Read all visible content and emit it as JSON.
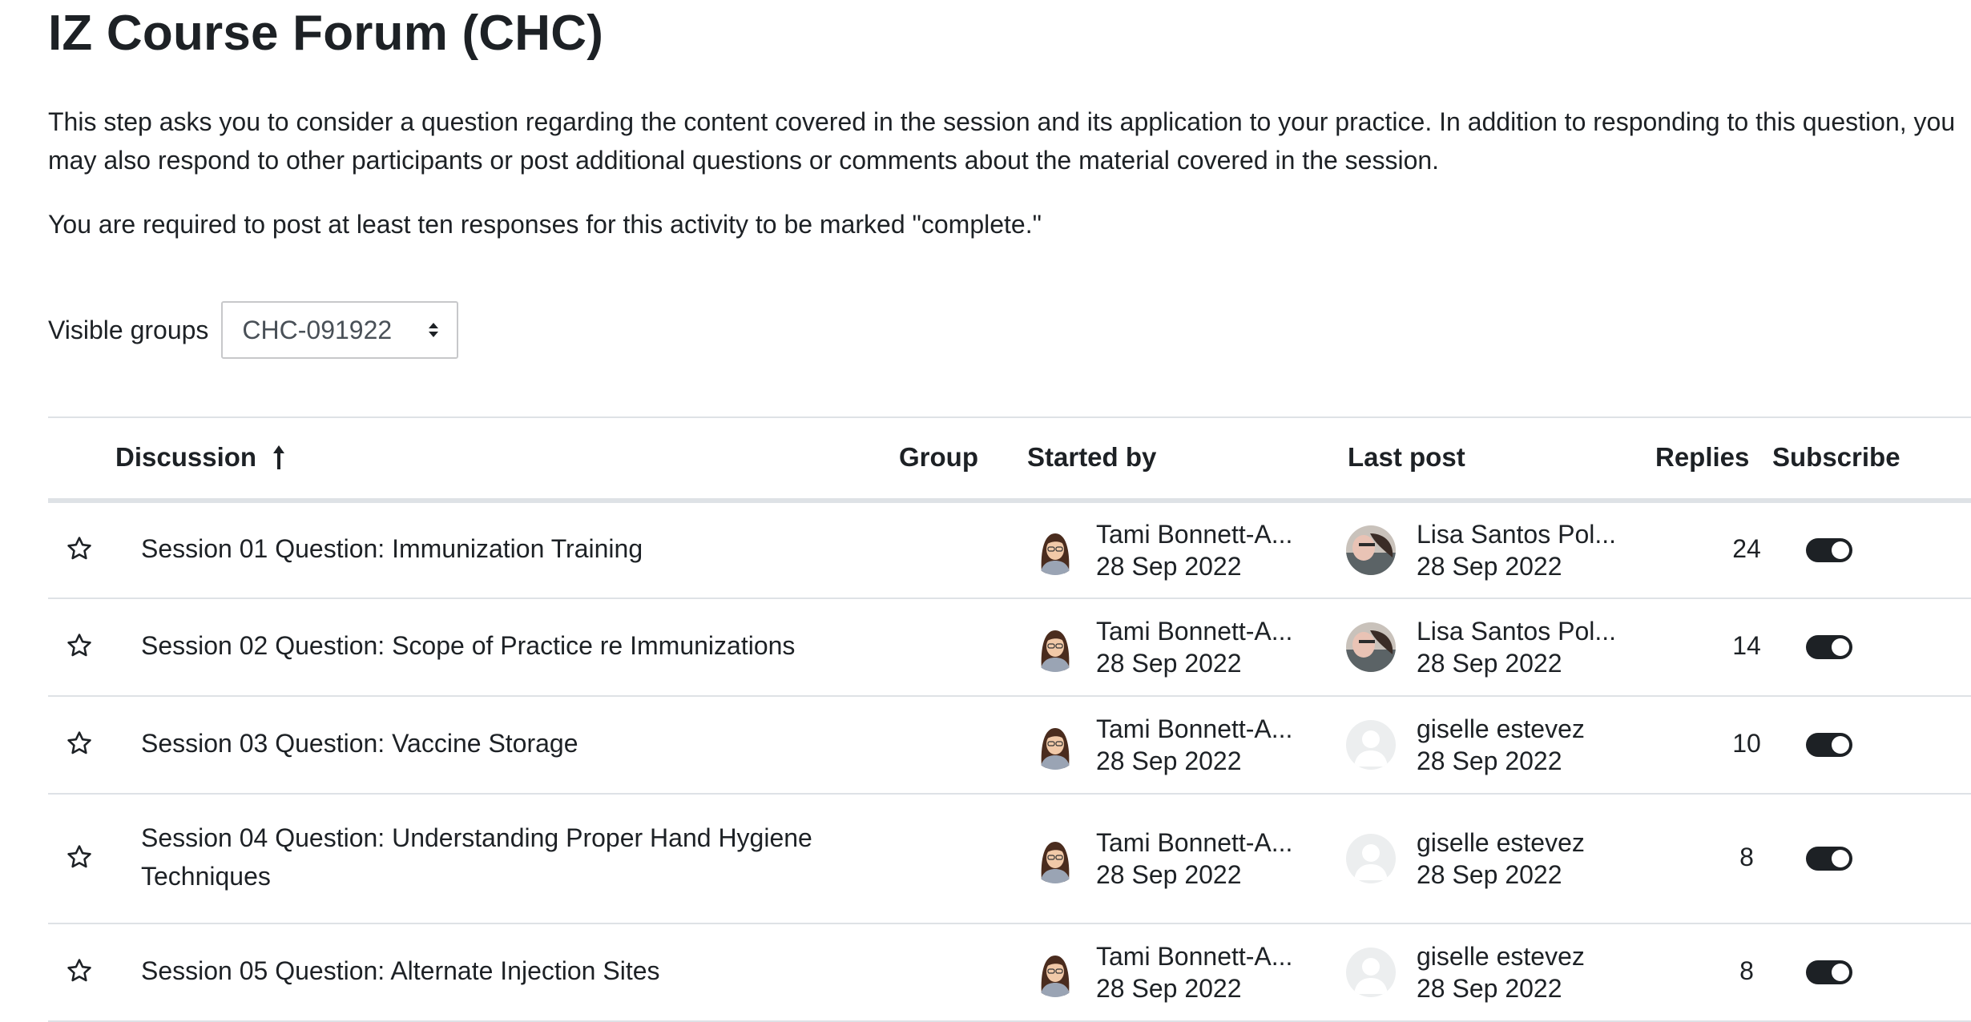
{
  "page": {
    "title": "IZ Course Forum (CHC)",
    "intro": "This step asks you to consider a question regarding the content covered in the session and its application to your practice. In addition to responding to this question, you may also respond to other participants or post additional questions or comments about the material covered in the session.",
    "requirement": "You are required to post at least ten responses for this activity to be marked \"complete.\""
  },
  "groups": {
    "label": "Visible groups",
    "selected": "CHC-091922"
  },
  "table": {
    "headers": {
      "discussion": "Discussion",
      "sort_indicator": "arrow-up-icon",
      "group": "Group",
      "started_by": "Started by",
      "last_post": "Last post",
      "replies": "Replies",
      "subscribe": "Subscribe"
    },
    "rows": [
      {
        "topic": "Session 01 Question: Immunization Training",
        "group": "",
        "started_by": "Tami Bonnett-A...",
        "started_date": "28 Sep 2022",
        "last_post_by": "Lisa Santos Pol...",
        "last_post_date": "28 Sep 2022",
        "last_post_avatar": "photo",
        "replies": "24",
        "subscribed": true
      },
      {
        "topic": "Session 02 Question: Scope of Practice re Immunizations",
        "group": "",
        "started_by": "Tami Bonnett-A...",
        "started_date": "28 Sep 2022",
        "last_post_by": "Lisa Santos Pol...",
        "last_post_date": "28 Sep 2022",
        "last_post_avatar": "photo",
        "replies": "14",
        "subscribed": true
      },
      {
        "topic": "Session 03 Question: Vaccine Storage",
        "group": "",
        "started_by": "Tami Bonnett-A...",
        "started_date": "28 Sep 2022",
        "last_post_by": "giselle estevez",
        "last_post_date": "28 Sep 2022",
        "last_post_avatar": "default",
        "replies": "10",
        "subscribed": true
      },
      {
        "topic": "Session 04 Question: Understanding Proper Hand Hygiene Techniques",
        "group": "",
        "started_by": "Tami Bonnett-A...",
        "started_date": "28 Sep 2022",
        "last_post_by": "giselle estevez",
        "last_post_date": "28 Sep 2022",
        "last_post_avatar": "default",
        "replies": "8",
        "subscribed": true
      },
      {
        "topic": "Session 05 Question: Alternate Injection Sites",
        "group": "",
        "started_by": "Tami Bonnett-A...",
        "started_date": "28 Sep 2022",
        "last_post_by": "giselle estevez",
        "last_post_date": "28 Sep 2022",
        "last_post_avatar": "default",
        "replies": "8",
        "subscribed": true
      }
    ]
  },
  "colors": {
    "text": "#1d2125",
    "border": "#dee2e6",
    "toggle_on": "#1d2125",
    "select_border": "#c7c8ca"
  }
}
